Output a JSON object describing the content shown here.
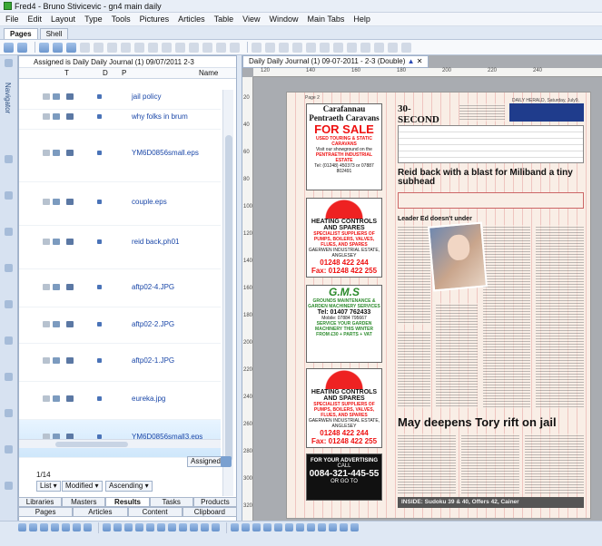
{
  "window": {
    "title": "Fred4 - Bruno Stivicevic - gn4 main daily"
  },
  "menu": [
    "File",
    "Edit",
    "Layout",
    "Type",
    "Tools",
    "Pictures",
    "Articles",
    "Table",
    "View",
    "Window",
    "Main Tabs",
    "Help"
  ],
  "toolbar_tabs": [
    {
      "label": "Pages",
      "active": true
    },
    {
      "label": "Shell",
      "active": false
    }
  ],
  "navigator": {
    "label": "Navigator"
  },
  "assigned_panel": {
    "title": "Assigned is Daily Daily Journal (1) 09/07/2011 2-3",
    "columns": {
      "t": "T",
      "d": "D",
      "p": "P",
      "name": "Name"
    },
    "rows": [
      {
        "label": "jail policy"
      },
      {
        "label": "why folks in brum"
      },
      {
        "label": "YM6D0856small.eps"
      },
      {
        "label": "couple.eps"
      },
      {
        "label": "reid back,ph01"
      },
      {
        "label": "aftp02-4.JPG"
      },
      {
        "label": "aftp02-2.JPG"
      },
      {
        "label": "aftp02-1.JPG"
      },
      {
        "label": "eureka.jpg"
      },
      {
        "label": "YM6D0856small3.eps"
      }
    ],
    "assigned_select": "Assigned",
    "pager": "1/14",
    "view_select": "List",
    "sort_select": "Modified",
    "order_select": "Ascending"
  },
  "bottom_tabs_row1": [
    {
      "label": "Libraries",
      "active": false
    },
    {
      "label": "Masters",
      "active": false
    },
    {
      "label": "Results",
      "active": true
    },
    {
      "label": "Tasks",
      "active": false
    },
    {
      "label": "Products",
      "active": false
    }
  ],
  "bottom_tabs_row2": [
    {
      "label": "Pages",
      "active": false
    },
    {
      "label": "Articles",
      "active": false
    },
    {
      "label": "Content",
      "active": false
    },
    {
      "label": "Clipboard",
      "active": false
    }
  ],
  "document": {
    "tab": "Daily Daily Journal (1) 09-07-2011 - 2-3 (Double)",
    "ruler_h": [
      "120",
      "140",
      "160",
      "180",
      "200",
      "220",
      "240"
    ],
    "ruler_v": [
      "20",
      "40",
      "60",
      "80",
      "100",
      "120",
      "140",
      "160",
      "180",
      "200",
      "220",
      "240",
      "260",
      "280",
      "300",
      "320"
    ]
  },
  "page": {
    "page_no": "Page 2",
    "masthead": "DAILY HERALD, Saturday, July9, 2011",
    "challenge": "30-SECOND CHALLENGE",
    "headline1": "Reid back with a blast for Miliband a tiny subhead",
    "kicker": "Leader Ed doesn't under",
    "headline2": "May deepens Tory rift on jail",
    "inside": "INSIDE: Sudoku 39 & 40, Offers 42, Cainer",
    "ads": {
      "caravans": {
        "brand": "Carafannau Pentraeth Caravans",
        "for_sale": "FOR SALE",
        "sub": "USED TOURING & STATIC CARAVANS",
        "visit": "Visit our showground on the",
        "estate": "PENTRAETH INDUSTRIAL ESTATE",
        "tel": "Tel: (01248) 450373 or 07887 802491"
      },
      "heating1": {
        "title": "HEATING CONTROLS AND SPARES",
        "sub": "SPECIALIST SUPPLIERS OF PUMPS, BOILERS, VALVES, FLUES, AND SPARES",
        "loc": "GAERWEN INDUSTRIAL ESTATE, ANGLESEY",
        "tel": "01248 422 244",
        "fax": "Fax: 01248 422 255"
      },
      "gms": {
        "logo": "G.M.S",
        "title": "GROUNDS MAINTENANCE & GARDEN MACHINERY SERVICES",
        "tel": "Tel: 01407 762433",
        "mobile": "Mobile: 07884 795667",
        "service": "SERVICE YOUR GARDEN MACHINERY THIS WINTER",
        "price": "FROM £30 + PARTS + VAT"
      },
      "heating2": {
        "title": "HEATING CONTROLS AND SPARES",
        "sub": "SPECIALIST SUPPLIERS OF PUMPS, BOILERS, VALVES, FLUES, AND SPARES",
        "loc": "GAERWEN INDUSTRIAL ESTATE, ANGLESEY",
        "tel": "01248 422 244",
        "fax": "Fax: 01248 422 255"
      },
      "advertising": {
        "line1": "FOR YOUR ADVERTISING",
        "line2": "CALL",
        "phone": "0084-321-445-55",
        "line3": "OR GO TO"
      }
    }
  }
}
